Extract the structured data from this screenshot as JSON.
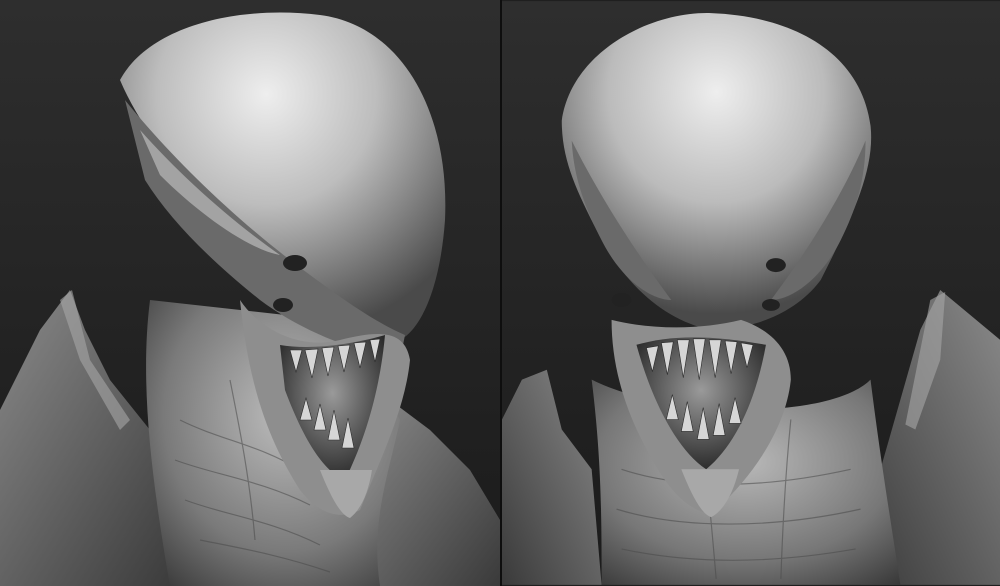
{
  "scene": {
    "views": [
      "three-quarter-left",
      "front"
    ],
    "colors": {
      "background_top": "#2f2f2f",
      "background_bottom": "#1a1a1a",
      "clay_light": "#e6e6e6",
      "clay_mid": "#9c9c9c",
      "clay_dark": "#3a3a3a",
      "cavity": "#111111"
    }
  }
}
